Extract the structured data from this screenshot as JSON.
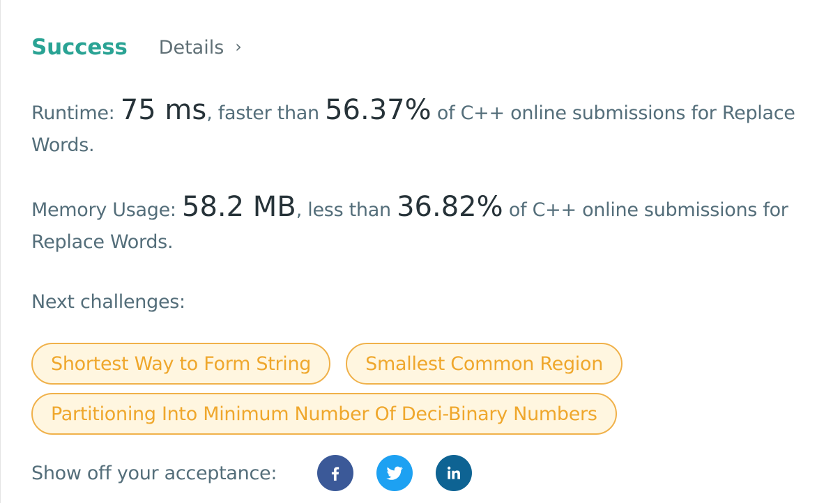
{
  "header": {
    "status": "Success",
    "details_label": "Details",
    "details_chevron": "›"
  },
  "runtime": {
    "prefix": "Runtime: ",
    "value": "75 ms",
    "middle": ", faster than ",
    "percent": "56.37%",
    "suffix": " of C++ online submissions for Replace Words."
  },
  "memory": {
    "prefix": "Memory Usage: ",
    "value": "58.2 MB",
    "middle": ", less than ",
    "percent": "36.82%",
    "suffix": " of C++ online submissions for Replace Words."
  },
  "next": {
    "label": "Next challenges:",
    "challenges": [
      "Shortest Way to Form String",
      "Smallest Common Region",
      "Partitioning Into Minimum Number Of Deci-Binary Numbers"
    ]
  },
  "share": {
    "label": "Show off your acceptance:",
    "icons": [
      {
        "name": "facebook-icon",
        "color": "#3b5998"
      },
      {
        "name": "twitter-icon",
        "color": "#1da1f2"
      },
      {
        "name": "linkedin-icon",
        "color": "#0e6393"
      }
    ]
  },
  "colors": {
    "success": "#2aa394",
    "tag_border": "#f0b14a",
    "tag_bg": "#fff6e0",
    "tag_text": "#efa72c",
    "body_text": "#546e7a"
  }
}
